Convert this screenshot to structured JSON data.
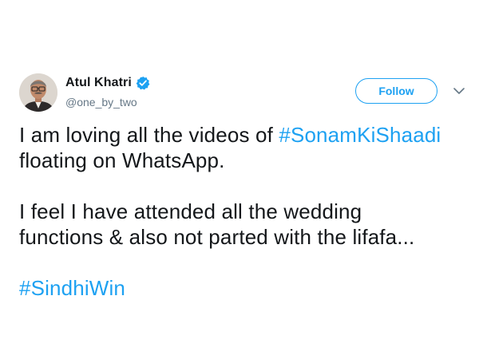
{
  "author": {
    "display_name": "Atul Khatri",
    "handle": "@one_by_two",
    "verified": true,
    "avatar_icon": "profile-photo"
  },
  "actions": {
    "follow_label": "Follow",
    "menu_icon": "chevron-down-icon"
  },
  "tweet": {
    "line1_text": "I am loving all the videos of ",
    "line1_hashtag": "#SonamKiShaadi",
    "line2_text": "floating on WhatsApp.",
    "line3_text": "I feel I have attended all the wedding",
    "line4_text": "functions & also not parted with the lifafa...",
    "hashtag2": "#SindhiWin"
  },
  "colors": {
    "accent": "#1da1f2",
    "text": "#14171a",
    "secondary": "#657786"
  }
}
